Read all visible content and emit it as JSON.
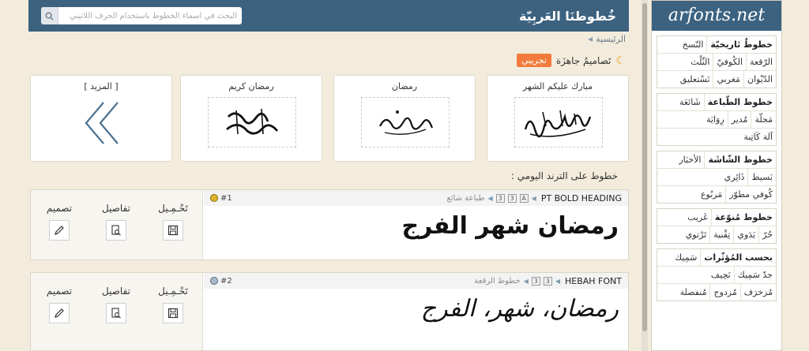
{
  "header": {
    "site_title": "خُطوطنَا العَربِيّة",
    "search_placeholder": "البحث في أسماء الخطوط باستخدام الحرف اللاتيني"
  },
  "breadcrumb": {
    "home": "الرئيسية"
  },
  "ready_designs": {
    "label": "تَصاميمُ جاهزَة",
    "tag": "تجريبي"
  },
  "cards": [
    {
      "title": "مبارك عليكم الشهر"
    },
    {
      "title": "رمضان"
    },
    {
      "title": "رمضان كريم"
    },
    {
      "title": "[ المزيد ]"
    }
  ],
  "trending_title": "خطوط على الترند اليومي :",
  "fonts": [
    {
      "rank": "#1",
      "name": "PT BOLD HEADING",
      "badges": [
        "A",
        "3",
        "3"
      ],
      "category": "طباعة شائع",
      "sample": "رمضان شهر الفرج",
      "medal_color": "#e0b52a",
      "actions": {
        "download": "تَحْـمِـيل",
        "details": "تفاصيل",
        "design": "تصميم"
      }
    },
    {
      "rank": "#2",
      "name": "HEBAH FONT",
      "badges": [
        "3",
        "3"
      ],
      "category": "خطوط الرقعة",
      "sample": "رمضان، شهر، الفرج",
      "medal_color": "#a9b8c8",
      "actions": {
        "download": "تَحْـمِـيل",
        "details": "تفاصيل",
        "design": "تصميم"
      }
    }
  ],
  "sidebar": {
    "logo": "arfonts.net",
    "categories": [
      {
        "rows": [
          [
            "خطوطٌ تَاريخيّة",
            "النّسخ"
          ],
          [
            "الرّقعة",
            "الكُوفيّ",
            "الثّلُث"
          ],
          [
            "الدّيْوان",
            "مَغربي",
            "نَسْتعليق"
          ]
        ]
      },
      {
        "rows": [
          [
            "خطوط الطّباعة",
            "شَائعَة"
          ],
          [
            "مَجلّة",
            "مُدير",
            "رِوَايَة"
          ],
          [
            "آلة كَاتِبة"
          ]
        ]
      },
      {
        "rows": [
          [
            "خطوط الشّاشَة",
            "الأخبَار"
          ],
          [
            "بَسيط",
            "ذَائِري"
          ],
          [
            "كُوفي مطوّر",
            "مَربُوع"
          ]
        ]
      },
      {
        "rows": [
          [
            "خطوط مُنوّعة",
            "غَريب"
          ],
          [
            "حُرّ",
            "يَدَوي",
            "تِقْنية",
            "تَرْتوي"
          ]
        ]
      },
      {
        "rows": [
          [
            "بحسب المُؤثّرات",
            "سَمِيك"
          ],
          [
            "جدّ سَمِيك",
            "نَحِيف"
          ],
          [
            "مُزخرَف",
            "مُزدوج",
            "مُنفصلة"
          ]
        ]
      }
    ]
  }
}
